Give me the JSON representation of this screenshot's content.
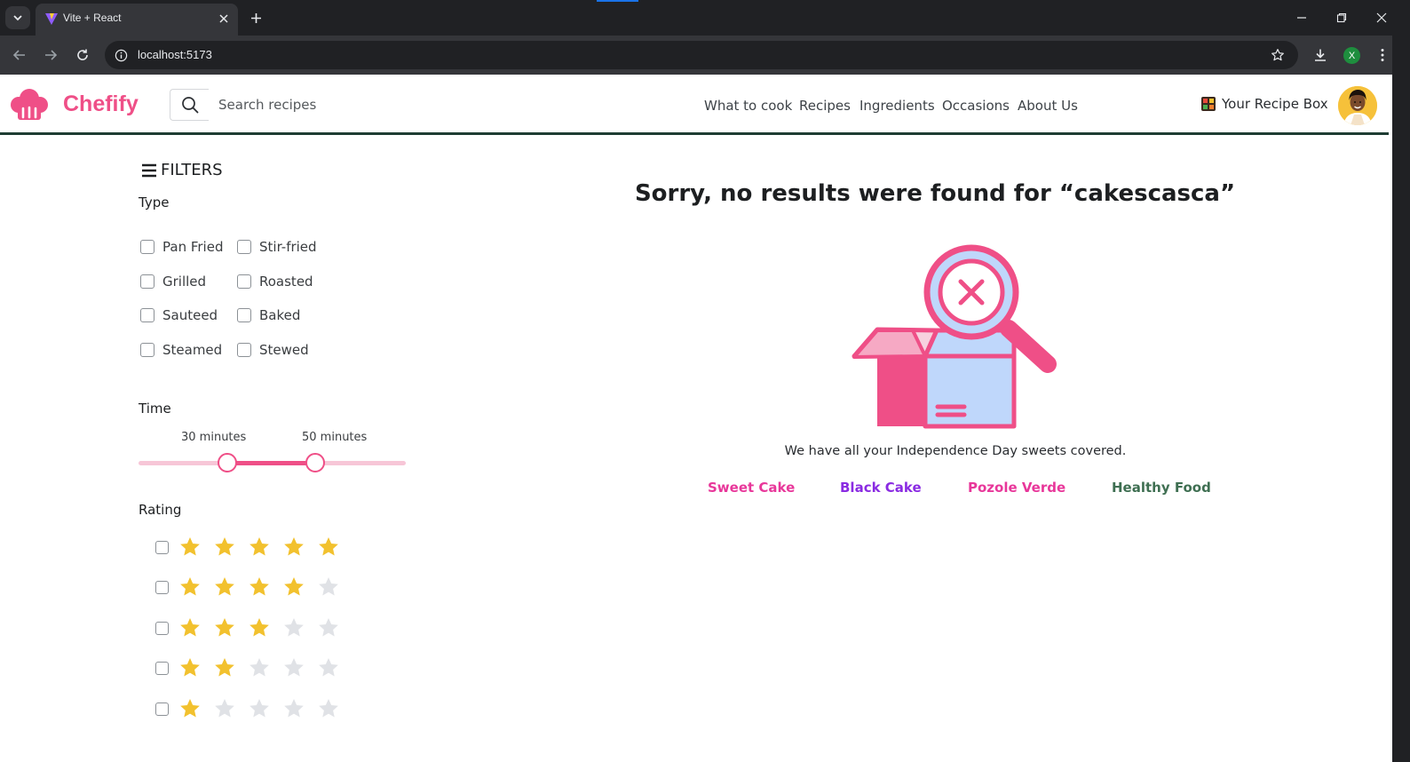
{
  "browser": {
    "tab_title": "Vite + React",
    "url": "localhost:5173",
    "profile_initial": "X",
    "theme_bg": "#202124"
  },
  "header": {
    "brand": "Chefify",
    "brand_color": "#ef4f87",
    "search_placeholder": "Search recipes",
    "nav": [
      "What to cook",
      "Recipes",
      "Ingredients",
      "Occasions",
      "About Us"
    ],
    "recipe_box_label": "Your Recipe Box"
  },
  "filters": {
    "title": "FILTERS",
    "type_label": "Type",
    "types": [
      "Pan Fried",
      "Stir-fried",
      "Grilled",
      "Roasted",
      "Sauteed",
      "Baked",
      "Steamed",
      "Stewed"
    ],
    "time_label": "Time",
    "time_min_label": "30 minutes",
    "time_max_label": "50 minutes",
    "time_min": 30,
    "time_max": 50,
    "rating_label": "Rating",
    "rating_rows": [
      5,
      4,
      3,
      2,
      1
    ],
    "star_color": "#f2c12e",
    "star_empty_color": "#e0e2e6"
  },
  "results": {
    "message_prefix": "Sorry, no results were found for ",
    "query": "“cakescasca”",
    "subtext": "We have all your Independence Day sweets covered.",
    "suggestions": [
      {
        "label": "Sweet Cake",
        "color": "#e8379a"
      },
      {
        "label": "Black Cake",
        "color": "#8a2be2"
      },
      {
        "label": "Pozole Verde",
        "color": "#e8379a"
      },
      {
        "label": "Healthy Food",
        "color": "#3f6f52"
      }
    ]
  }
}
